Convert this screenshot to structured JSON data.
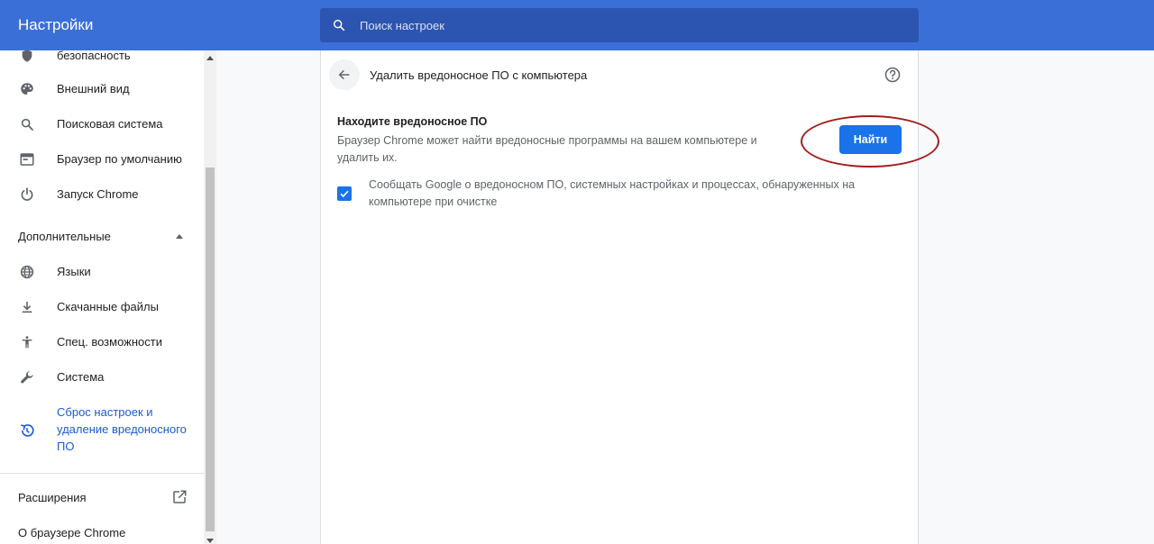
{
  "header": {
    "title": "Настройки",
    "search_placeholder": "Поиск настроек"
  },
  "sidebar": {
    "partial_item": "безопасность",
    "items": [
      {
        "label": "Внешний вид",
        "icon": "palette-icon"
      },
      {
        "label": "Поисковая система",
        "icon": "search-icon"
      },
      {
        "label": "Браузер по умолчанию",
        "icon": "browser-window-icon"
      },
      {
        "label": "Запуск Chrome",
        "icon": "power-icon"
      }
    ],
    "advanced_section": "Дополнительные",
    "advanced_items": [
      {
        "label": "Языки",
        "icon": "globe-icon"
      },
      {
        "label": "Скачанные файлы",
        "icon": "download-icon"
      },
      {
        "label": "Спец. возможности",
        "icon": "accessibility-icon"
      },
      {
        "label": "Система",
        "icon": "wrench-icon"
      }
    ],
    "active_item": {
      "line1": "Сброс настроек и",
      "line2": "удаление вредоносного",
      "line3": "ПО",
      "icon": "restore-icon"
    },
    "extensions_label": "Расширения",
    "about_label": "О браузере Chrome"
  },
  "main": {
    "title": "Удалить вредоносное ПО с компьютера",
    "section_title": "Находите вредоносное ПО",
    "section_desc": "Браузер Chrome может найти вредоносные программы на вашем компьютере и удалить их.",
    "find_button": "Найти",
    "checkbox_checked": true,
    "checkbox_label": "Сообщать Google о вредоносном ПО, системных настройках и процессах, обнаруженных на компьютере при очистке"
  },
  "colors": {
    "header": "#3b6fd8",
    "search_box": "#2c55b1",
    "accent": "#1a73e8",
    "highlight": "#a11d1d"
  }
}
